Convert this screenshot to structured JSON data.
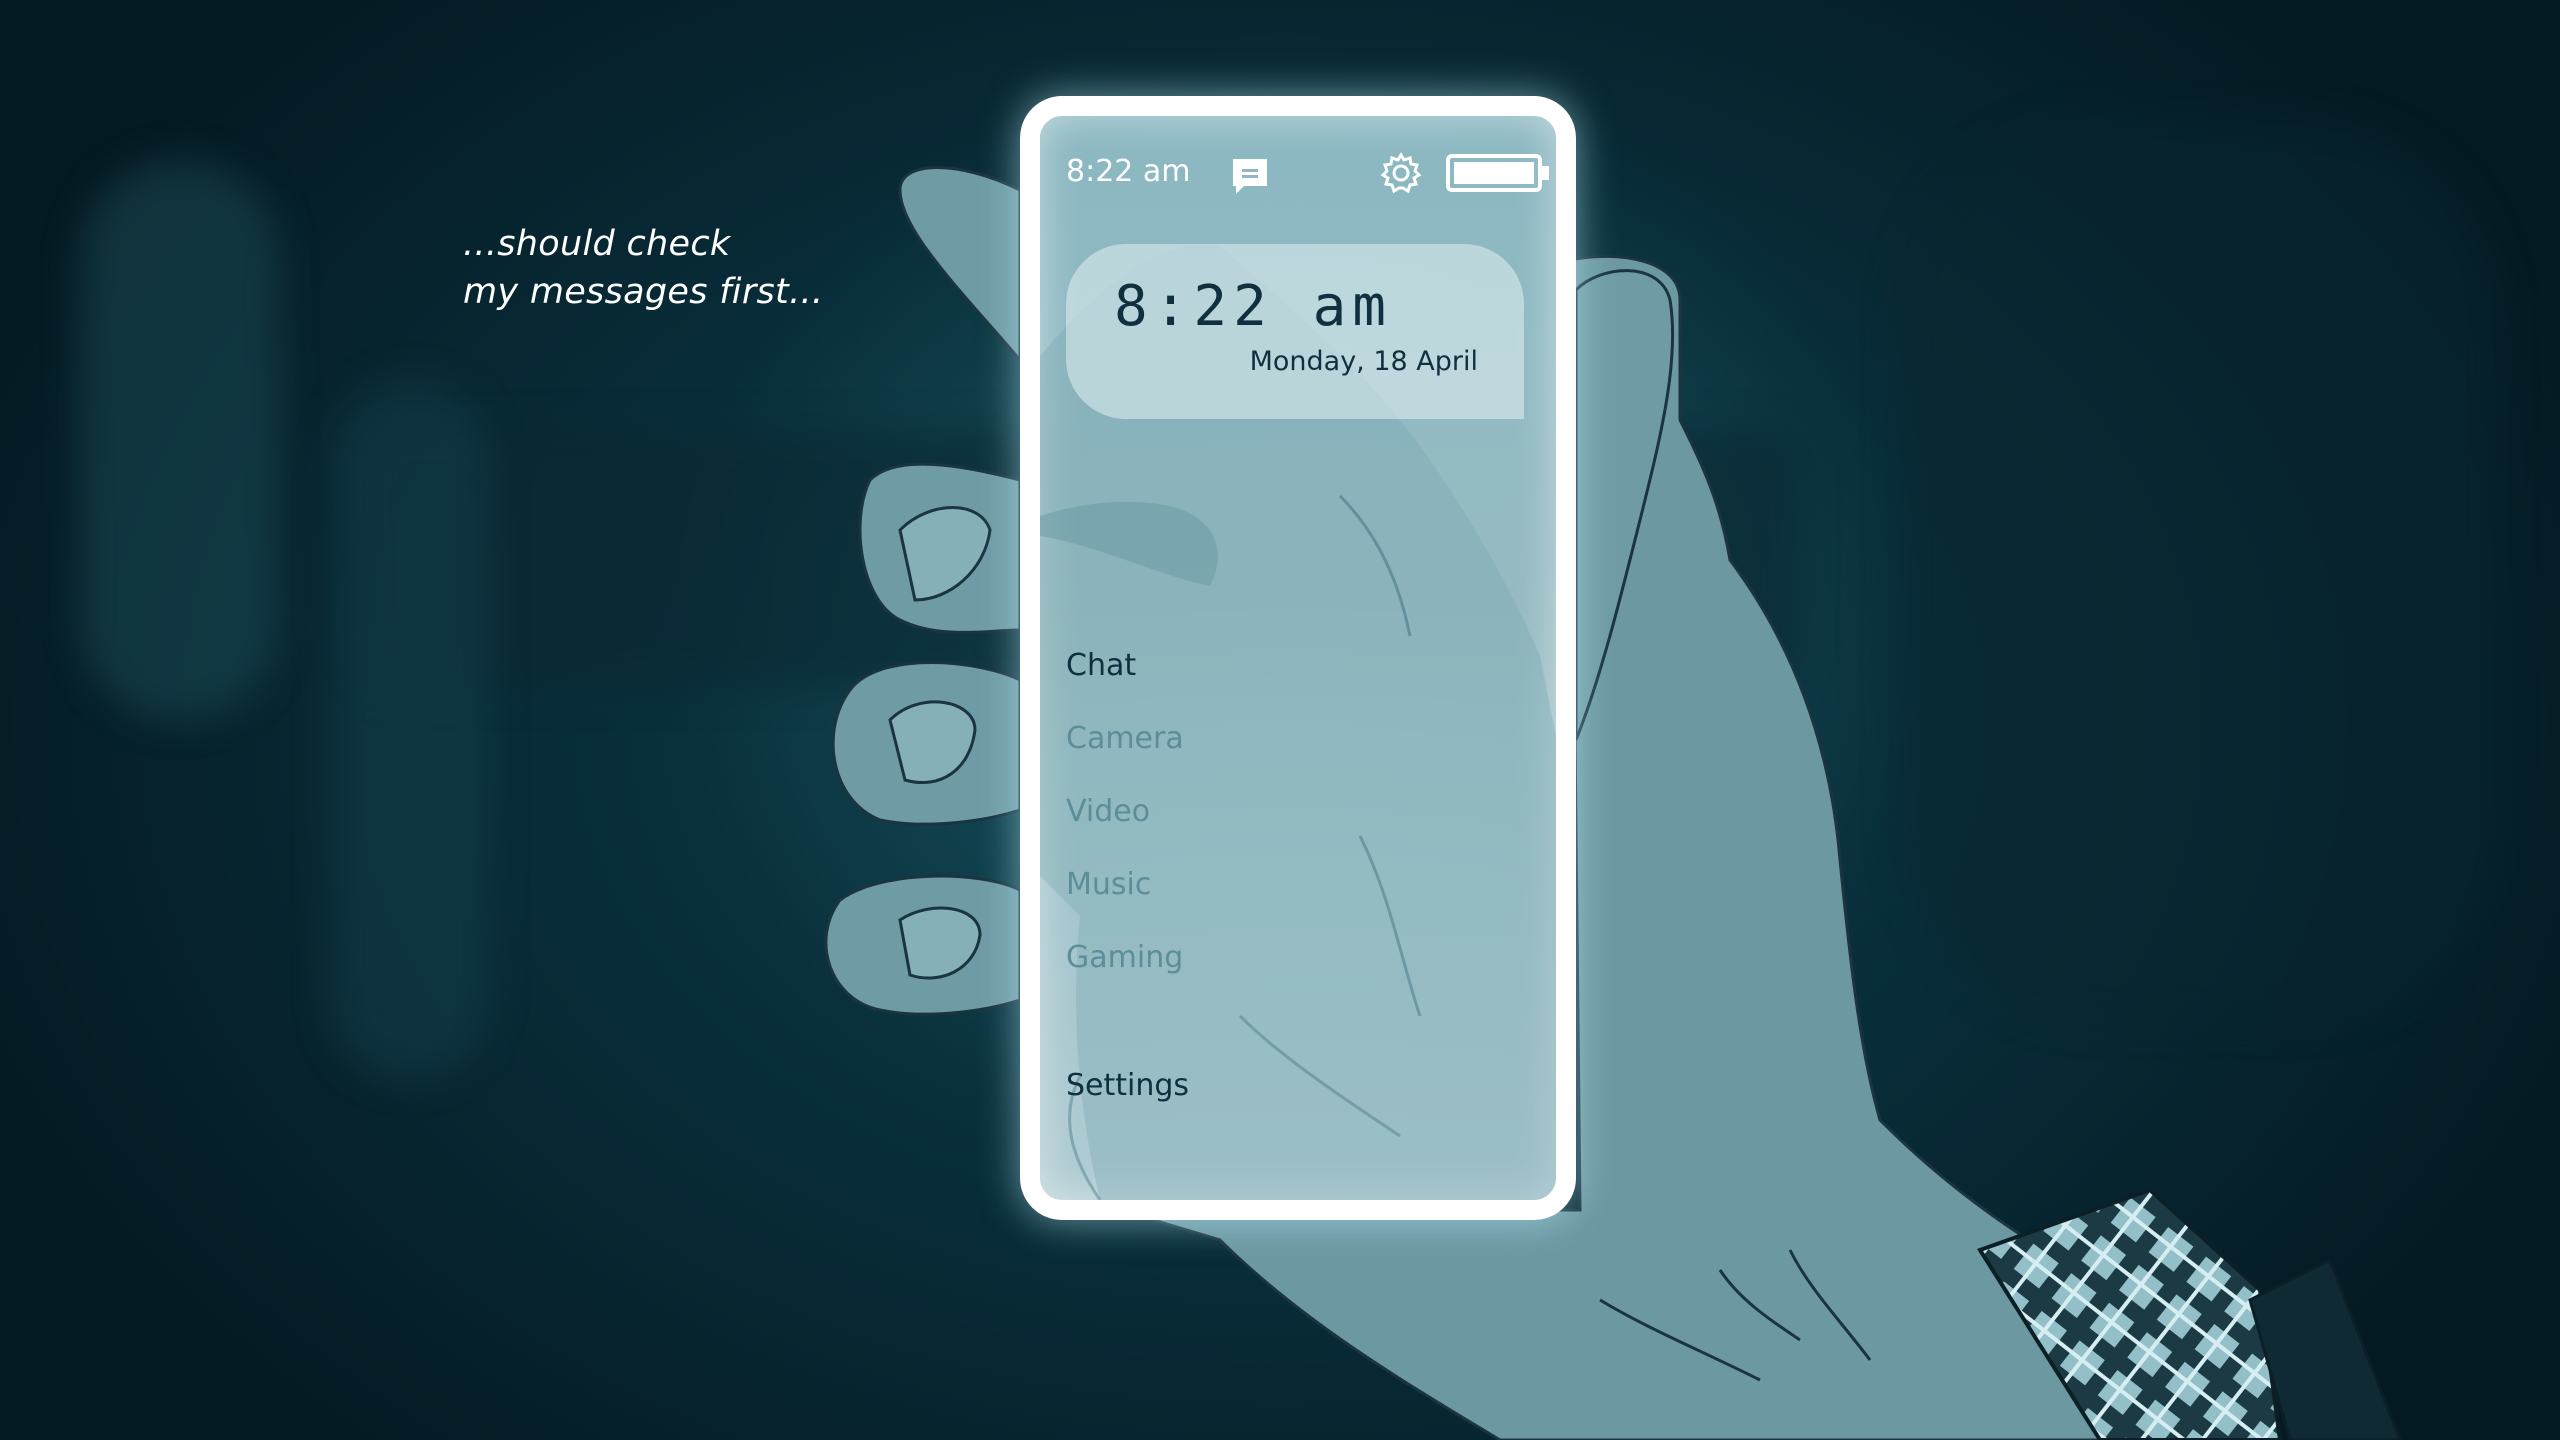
{
  "monologue": {
    "line1": "...should check",
    "line2": "my messages first..."
  },
  "phone": {
    "status_bar": {
      "time": "8:22 am",
      "icons": [
        "message-icon",
        "gear-icon",
        "battery-icon"
      ],
      "battery_level": 1.0
    },
    "clock": {
      "time": "8:22 am",
      "date": "Monday, 18 April"
    },
    "menu": {
      "items": [
        {
          "label": "Chat",
          "selected": true
        },
        {
          "label": "Camera",
          "selected": false
        },
        {
          "label": "Video",
          "selected": false
        },
        {
          "label": "Music",
          "selected": false
        },
        {
          "label": "Gaming",
          "selected": false
        }
      ],
      "settings_label": "Settings"
    }
  },
  "colors": {
    "background": "#0a3440",
    "phone_frame": "#ffffff",
    "menu_selected": "#0f3040",
    "menu_unselected": "#5c8e9a",
    "skin": "#6c98a2",
    "sleeve_plaid": "#a8d0d8"
  }
}
